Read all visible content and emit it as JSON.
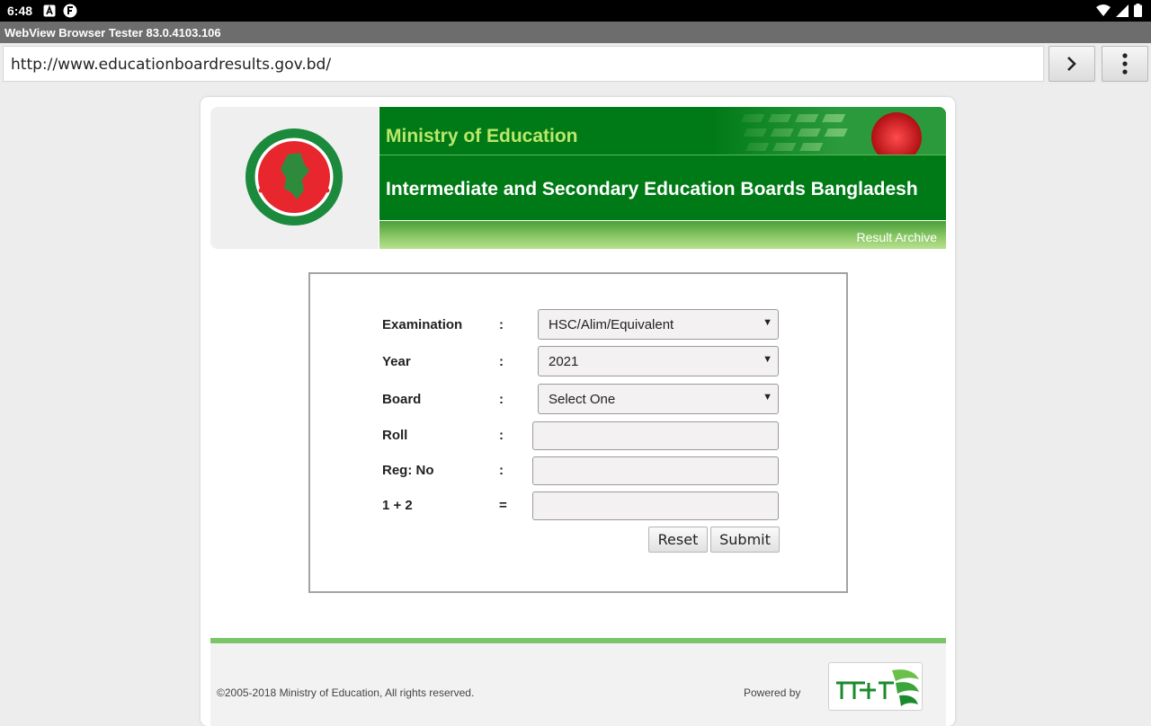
{
  "status_bar": {
    "time": "6:48"
  },
  "app": {
    "title": "WebView Browser Tester 83.0.4103.106"
  },
  "url_bar": {
    "url": "http://www.educationboardresults.gov.bd/"
  },
  "header": {
    "ministry": "Ministry of Education",
    "boards": "Intermediate and Secondary Education Boards Bangladesh",
    "archive_link": "Result Archive"
  },
  "form": {
    "examination": {
      "label": "Examination",
      "colon": ":",
      "value": "HSC/Alim/Equivalent"
    },
    "year": {
      "label": "Year",
      "colon": ":",
      "value": "2021"
    },
    "board": {
      "label": "Board",
      "colon": ":",
      "value": "Select One"
    },
    "roll": {
      "label": "Roll",
      "colon": ":",
      "value": ""
    },
    "reg": {
      "label": "Reg: No",
      "colon": ":",
      "value": ""
    },
    "captcha": {
      "label": "1 + 2",
      "colon": "=",
      "value": ""
    },
    "reset_label": "Reset",
    "submit_label": "Submit"
  },
  "footer": {
    "copyright": "©2005-2018 Ministry of Education, All rights reserved.",
    "powered_by": "Powered by"
  },
  "colors": {
    "banner_green": "#007a16",
    "ministry_text": "#b9e86a",
    "flag_red": "#e8262d"
  }
}
